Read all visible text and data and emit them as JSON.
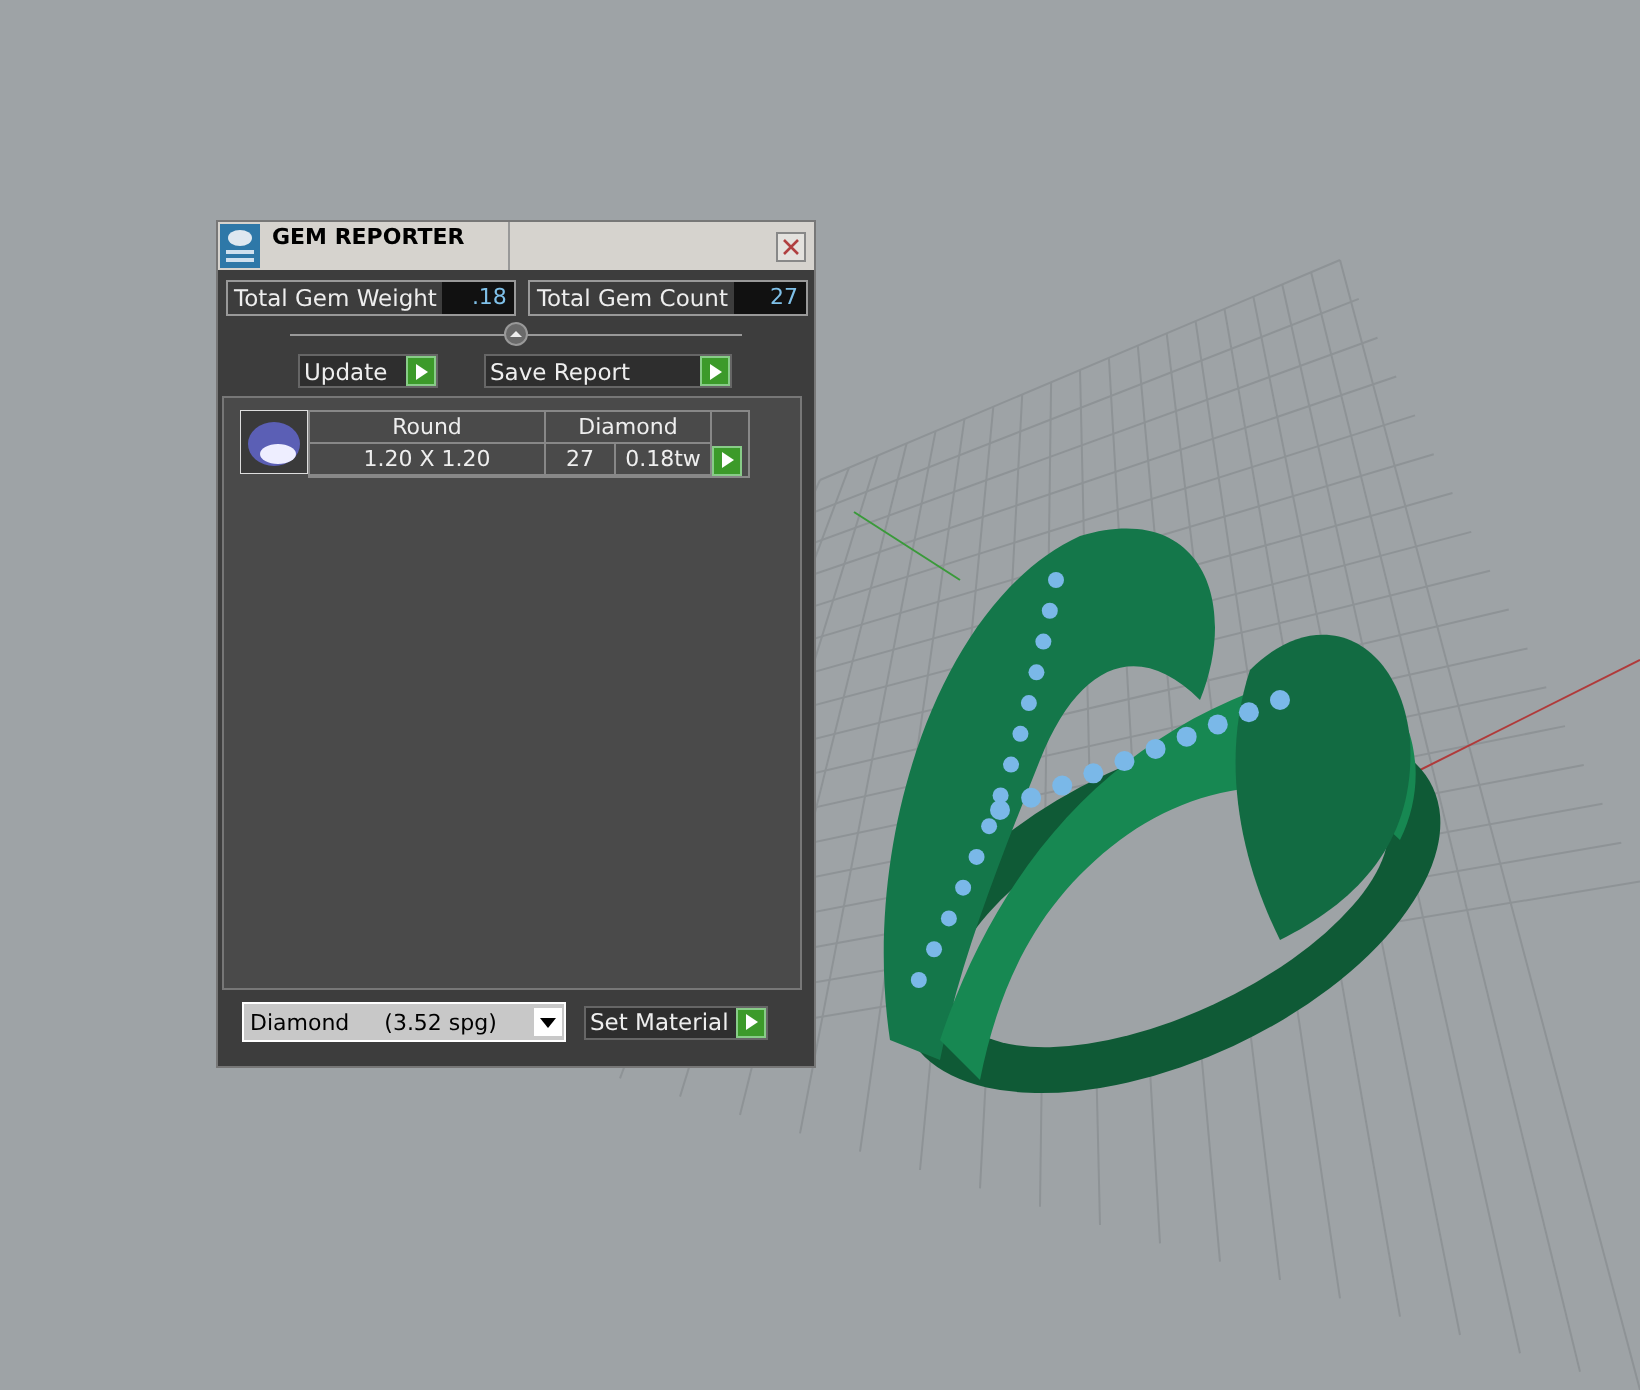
{
  "window": {
    "title": "GEM REPORTER"
  },
  "totals": [
    {
      "label": "Total Gem Weight",
      "value": ".18"
    },
    {
      "label": "Total Gem Count",
      "value": "27"
    }
  ],
  "buttons": [
    {
      "label": "Update",
      "kind": "small"
    },
    {
      "label": "Save Report",
      "kind": "wide"
    }
  ],
  "gems": [
    {
      "shape": "Round",
      "material": "Diamond",
      "size": "1.20 X 1.20",
      "count": "27",
      "weight": "0.18tw"
    }
  ],
  "material_select": {
    "value": "Diamond     (3.52 spg)"
  },
  "set_material_button": {
    "label": "Set Material"
  }
}
